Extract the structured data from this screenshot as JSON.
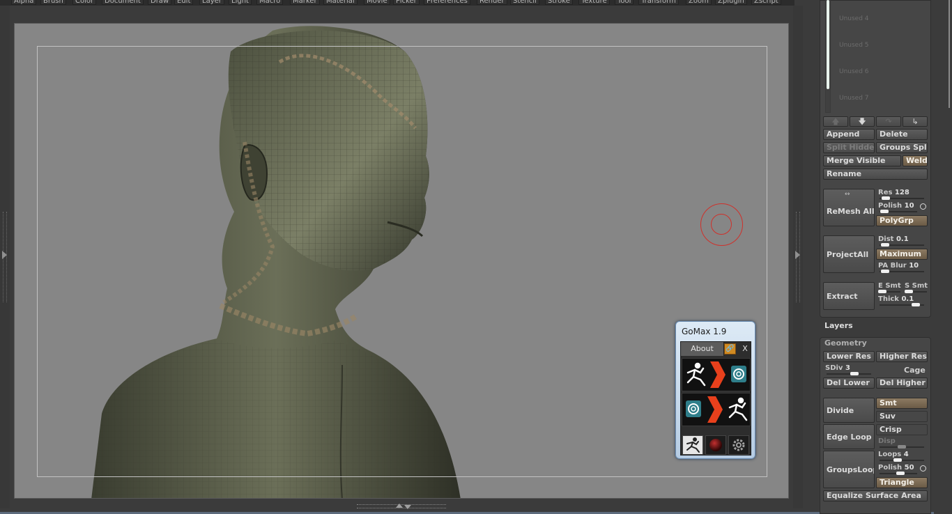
{
  "menubar": {
    "items": [
      "Alpha",
      "Brush",
      "Color",
      "Document",
      "Draw",
      "Edit",
      "Layer",
      "Light",
      "Macro",
      "Marker",
      "Material",
      "Movie",
      "Picker",
      "Preferences",
      "Render",
      "Stencil",
      "Stroke",
      "Texture",
      "Tool",
      "Transform",
      "Zoom",
      "Zplugin",
      "Zscript"
    ]
  },
  "subtool": {
    "slots": [
      "Unused 4",
      "Unused 5",
      "Unused 6",
      "Unused 7"
    ],
    "append": "Append",
    "delete": "Delete",
    "split_hidden": "Split Hidden",
    "groups_split": "Groups Split",
    "merge_visible": "Merge Visible",
    "weld": "Weld",
    "rename": "Rename",
    "remesh_all": "ReMesh All",
    "res_label": "Res",
    "res_value": "128",
    "polish_label": "Polish",
    "polish_value": "10",
    "polygrp": "PolyGrp",
    "project_all": "ProjectAll",
    "dist_label": "Dist",
    "dist_value": "0.1",
    "maximum": "Maximum",
    "pa_blur_label": "PA Blur",
    "pa_blur_value": "10",
    "extract": "Extract",
    "e_smt": "E Smt",
    "s_smt": "S Smt",
    "thick_label": "Thick",
    "thick_value": "0.1"
  },
  "layers": {
    "title": "Layers"
  },
  "geometry": {
    "title": "Geometry",
    "lower_res": "Lower Res",
    "higher_res": "Higher Res",
    "sdiv_label": "SDiv",
    "sdiv_value": "3",
    "cage": "Cage",
    "del_lower": "Del Lower",
    "del_higher": "Del Higher",
    "divide": "Divide",
    "smt": "Smt",
    "suv": "Suv",
    "edge_loop": "Edge Loop",
    "crisp": "Crisp",
    "disp": "Disp",
    "groups_loops": "GroupsLoops",
    "loops_label": "Loops",
    "loops_value": "4",
    "polish_label": "Polish",
    "polish_value": "50",
    "triangle": "Triangle",
    "equalize": "Equalize Surface Area"
  },
  "gomax": {
    "title": "GoMax 1.9",
    "about": "About",
    "close": "X"
  },
  "colors": {
    "accent_active": "#8c7a62",
    "brush_ring": "#d0302a",
    "gomax_arrow": "#e8401c"
  }
}
